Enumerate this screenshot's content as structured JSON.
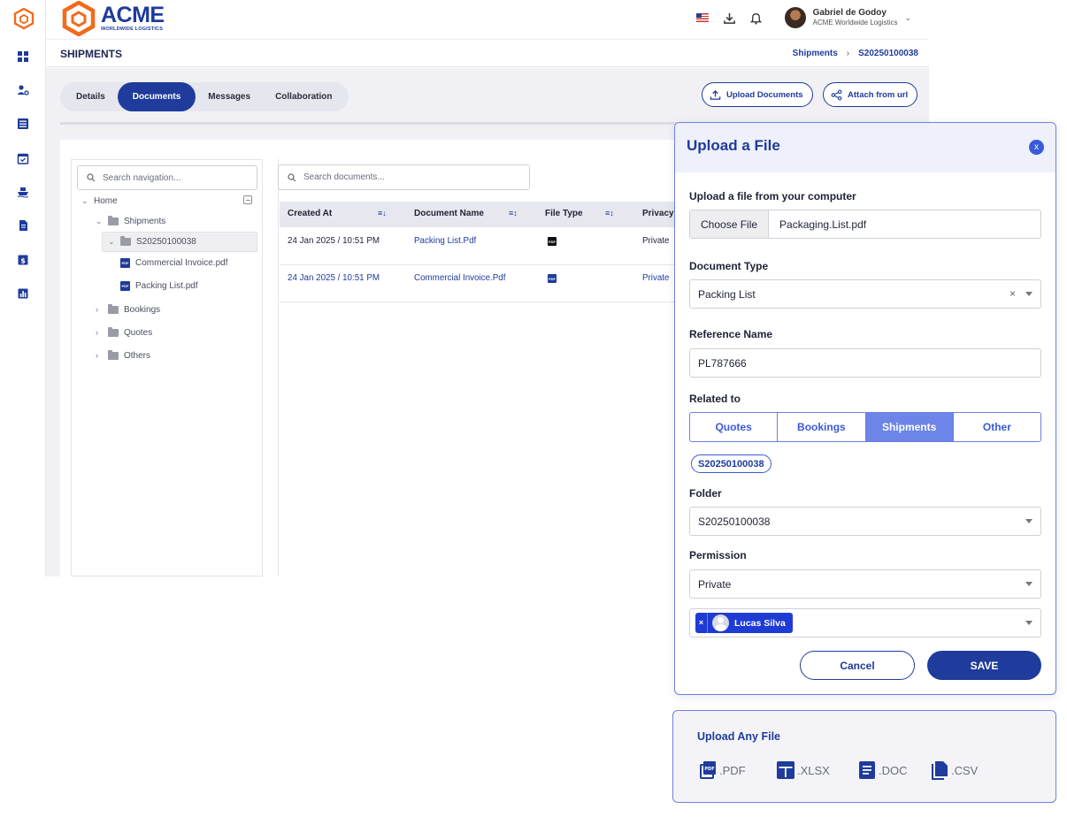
{
  "brand": {
    "name": "ACME",
    "tagline": "WORLDWIDE LOGISTICS"
  },
  "user": {
    "name": "Gabriel de Godoy",
    "org": "ACME Worldwide Logistics"
  },
  "page": {
    "title": "SHIPMENTS",
    "breadcrumb": [
      "Shipments",
      "S20250100038"
    ]
  },
  "tabs": [
    {
      "label": "Details",
      "active": false
    },
    {
      "label": "Documents",
      "active": true
    },
    {
      "label": "Messages",
      "active": false
    },
    {
      "label": "Collaboration",
      "active": false
    }
  ],
  "actions": {
    "upload": "Upload Documents",
    "attach": "Attach from url"
  },
  "navigation": {
    "search_placeholder": "Search navigation...",
    "tree": {
      "home": "Home",
      "shipments": "Shipments",
      "shipment_id": "S20250100038",
      "files": [
        "Commercial Invoice.pdf",
        "Packing List.pdf"
      ],
      "folders": [
        "Bookings",
        "Quotes",
        "Others"
      ]
    }
  },
  "documents": {
    "search_placeholder": "Search documents...",
    "columns": [
      "Created At",
      "Document Name",
      "File Type",
      "Privacy"
    ],
    "rows": [
      {
        "created": "24 Jan 2025 / 10:51 PM",
        "name": "Packing List.Pdf",
        "type": "PDF",
        "privacy": "Private"
      },
      {
        "created": "24 Jan 2025 / 10:51 PM",
        "name": "Commercial Invoice.Pdf",
        "type": "PDF",
        "privacy": "Private"
      }
    ]
  },
  "modal": {
    "title": "Upload a File",
    "close": "x",
    "file_label": "Upload a file from your computer",
    "choose_file": "Choose File",
    "file_name": "Packaging.List.pdf",
    "doc_type_label": "Document Type",
    "doc_type_value": "Packing List",
    "ref_label": "Reference Name",
    "ref_value": "PL787666",
    "related_label": "Related to",
    "related_options": [
      "Quotes",
      "Bookings",
      "Shipments",
      "Other"
    ],
    "related_active": "Shipments",
    "related_tag": "S20250100038",
    "folder_label": "Folder",
    "folder_value": "S20250100038",
    "permission_label": "Permission",
    "permission_value": "Private",
    "shared_user": "Lucas Silva",
    "chip_remove": "×",
    "cancel": "Cancel",
    "save": "SAVE"
  },
  "upload_card": {
    "title": "Upload  Any File",
    "types": [
      ".PDF",
      ".XLSX",
      ".DOC",
      ".CSV"
    ]
  },
  "colors": {
    "primary": "#1f3b9b",
    "accent": "#3a5bd9",
    "brand_orange": "#f26a1b"
  }
}
